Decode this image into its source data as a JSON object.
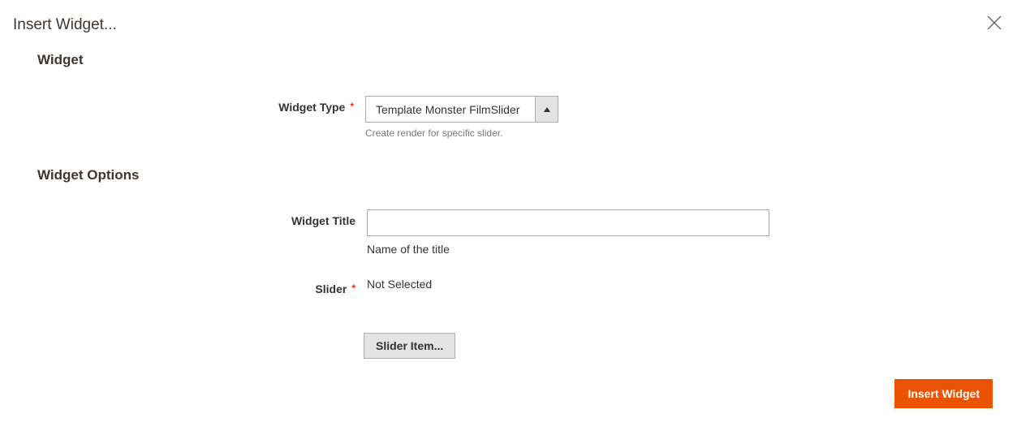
{
  "modal": {
    "title": "Insert Widget..."
  },
  "sections": {
    "widget": "Widget",
    "options": "Widget Options"
  },
  "fields": {
    "widgetType": {
      "label": "Widget Type",
      "value": "Template Monster FilmSlider",
      "help": "Create render for specific slider."
    },
    "widgetTitle": {
      "label": "Widget Title",
      "value": "",
      "help": "Name of the title"
    },
    "slider": {
      "label": "Slider",
      "value": "Not Selected"
    },
    "sliderItem": {
      "buttonLabel": "Slider Item..."
    }
  },
  "buttons": {
    "insert": "Insert Widget"
  }
}
